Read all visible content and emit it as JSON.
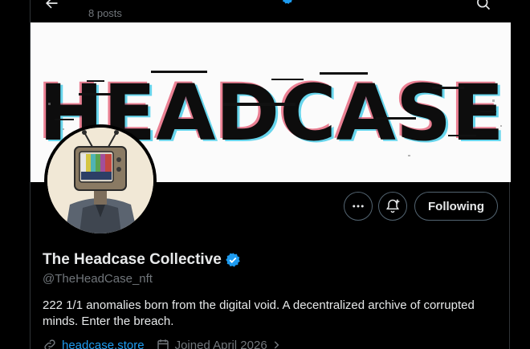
{
  "header": {
    "posts_count": "8 posts",
    "back_icon": "arrow-left-icon",
    "search_icon": "search-icon"
  },
  "banner": {
    "text": "HEADCASE"
  },
  "actions": {
    "more_icon": "more-horizontal-icon",
    "notify_icon": "bell-plus-icon",
    "following_label": "Following"
  },
  "profile": {
    "display_name": "The Headcase Collective",
    "handle": "@TheHeadCase_nft",
    "bio": "222 1/1 anomalies born from the digital void. A decentralized archive of corrupted minds. Enter the breach.",
    "website": "headcase.store",
    "joined": "Joined April 2026"
  },
  "colors": {
    "accent": "#1d9bf0",
    "text": "#e7e9ea",
    "muted": "#71767b",
    "border": "#536471",
    "background": "#000000"
  }
}
